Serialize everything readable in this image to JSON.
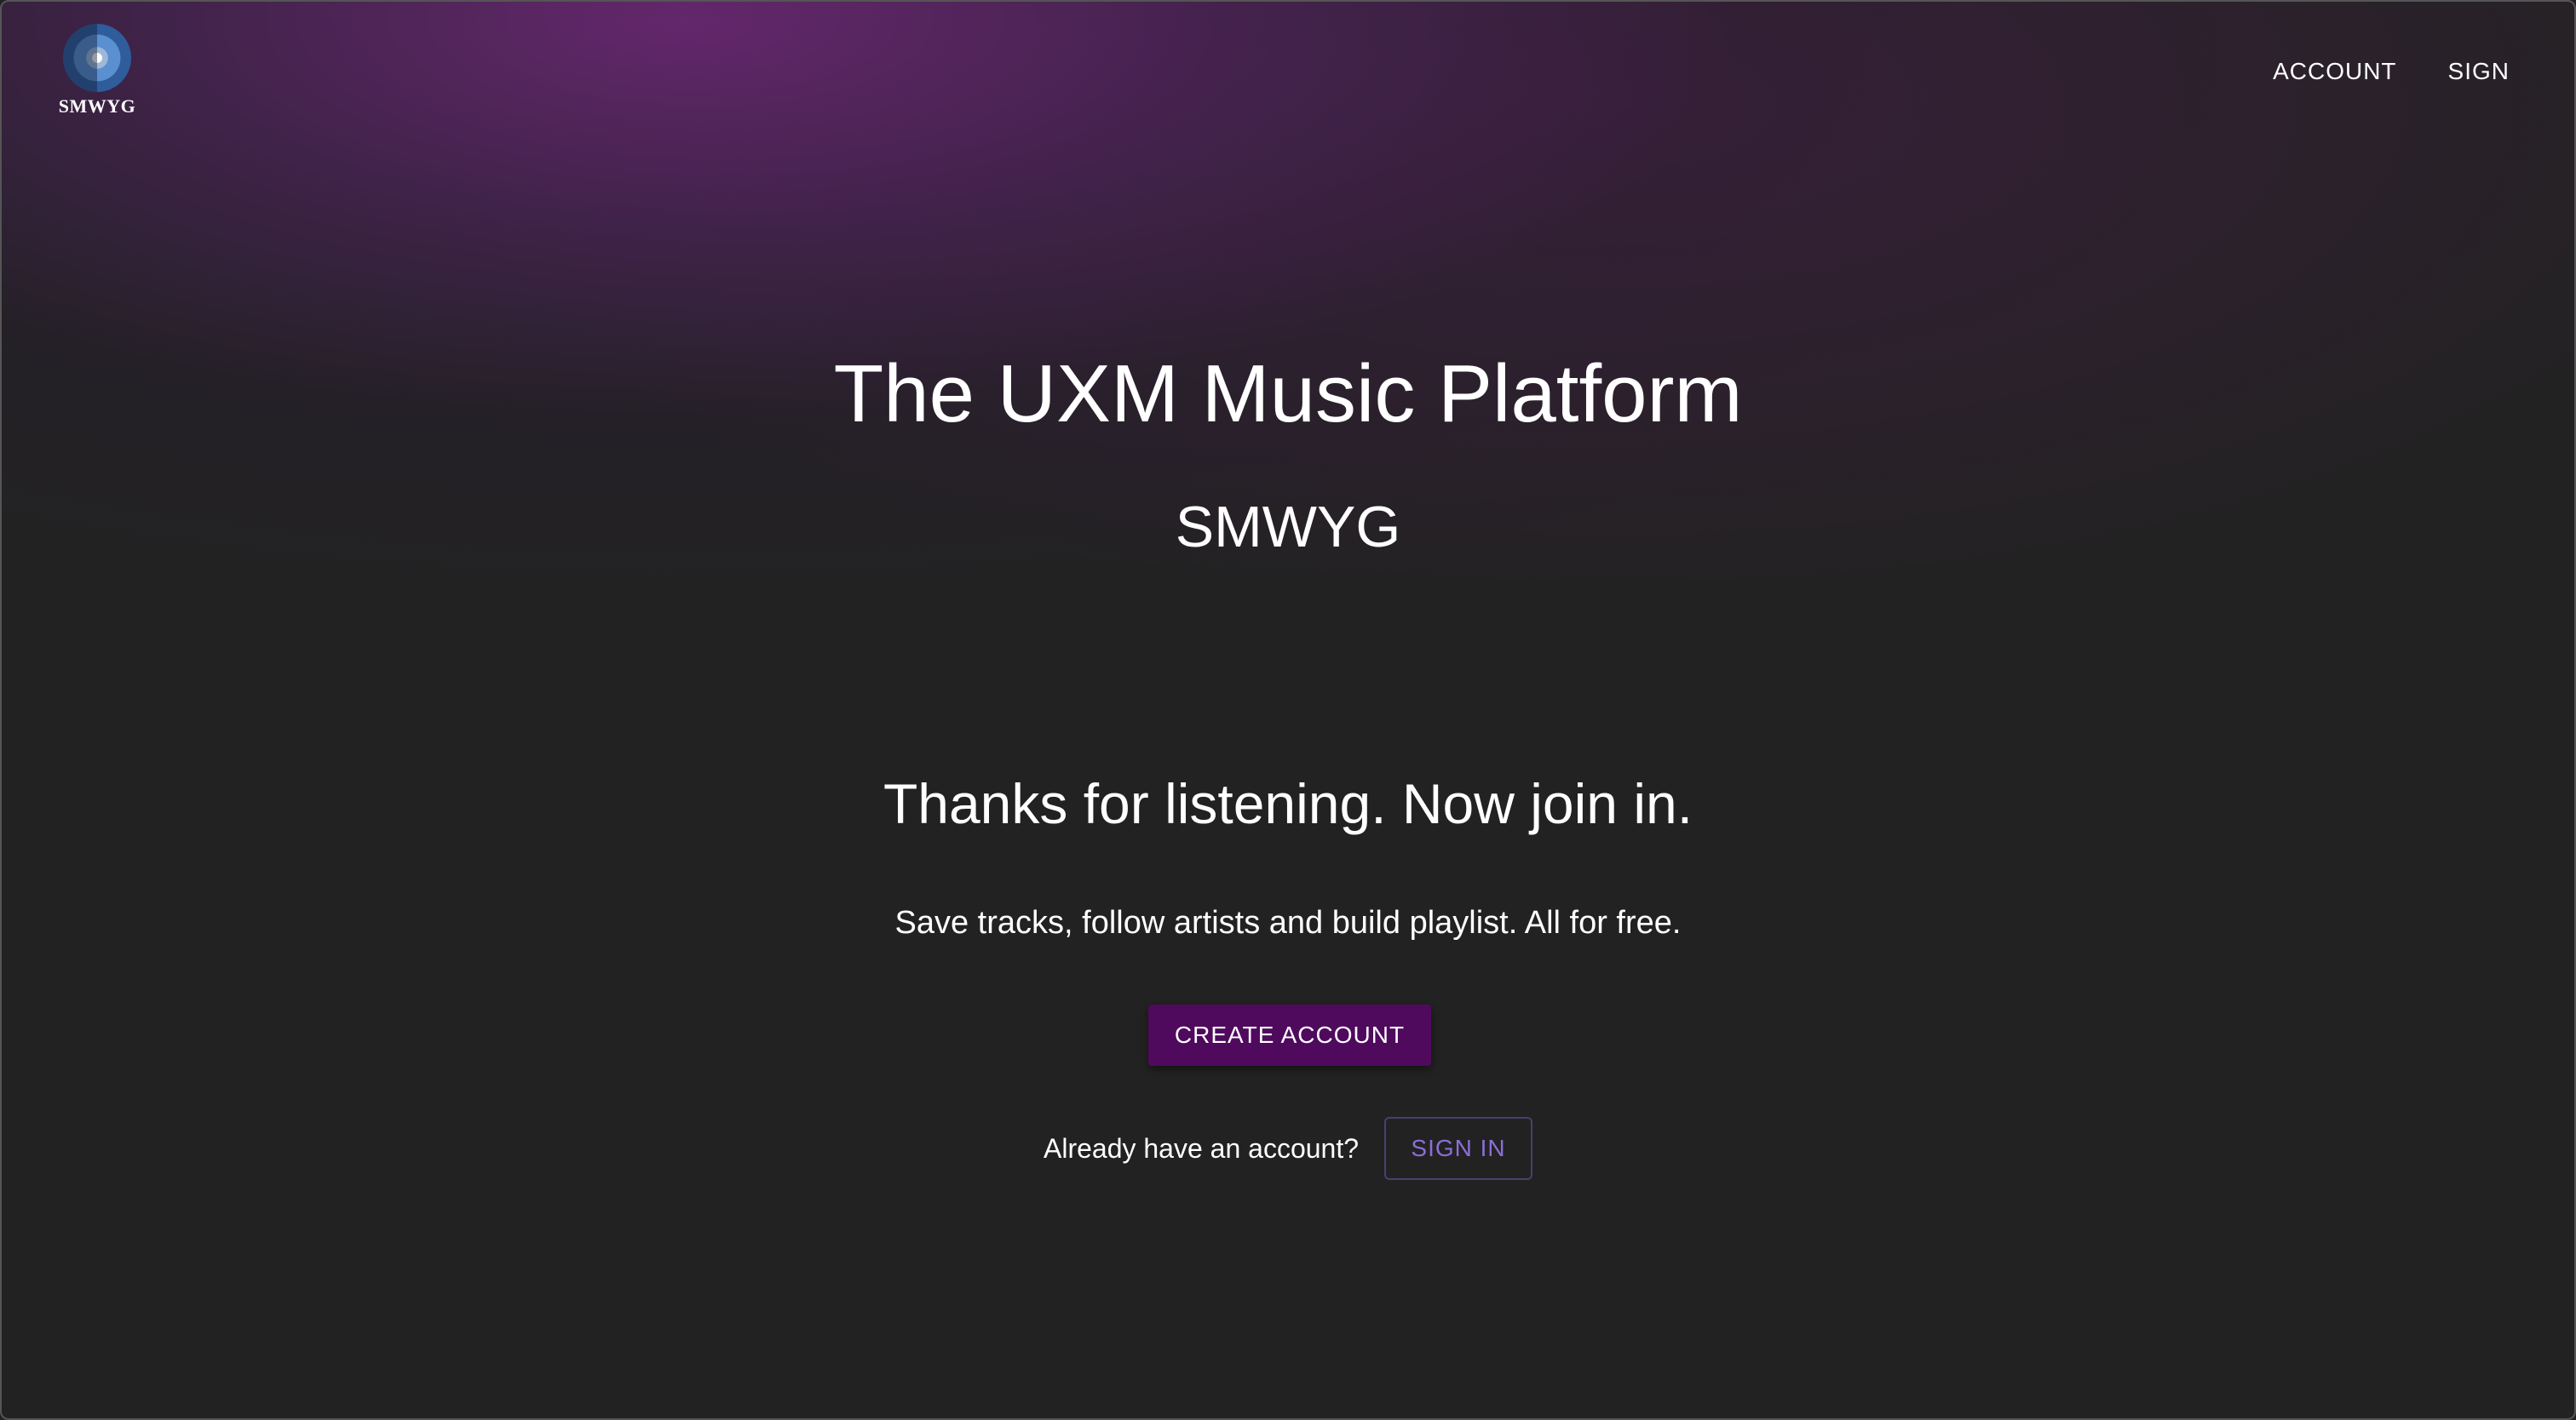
{
  "header": {
    "logo_text": "SMWYG",
    "nav": {
      "account": "ACCOUNT",
      "sign": "SIGN"
    }
  },
  "hero": {
    "title": "The UXM Music Platform",
    "subtitle": "SMWYG"
  },
  "cta": {
    "heading": "Thanks for listening. Now join in.",
    "text": "Save tracks, follow artists and build playlist. All for free.",
    "create_account": "CREATE ACCOUNT",
    "already_label": "Already have an account?",
    "sign_in": "SIGN IN"
  },
  "colors": {
    "background": "#222222",
    "accent_purple": "#4f0a5e",
    "sign_in_text": "#8b6fd6"
  },
  "icons": {
    "logo": "vinyl-disc-icon"
  }
}
